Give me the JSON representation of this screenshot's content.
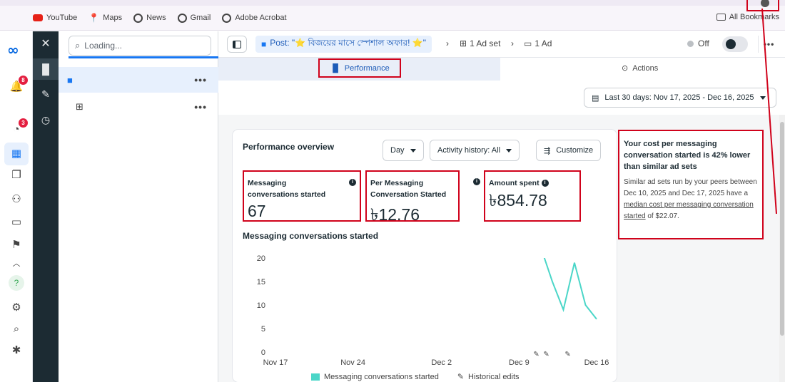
{
  "bookmarks": {
    "items": [
      {
        "label": "YouTube",
        "color": "#e62117"
      },
      {
        "label": "Maps",
        "color": "#34a853"
      },
      {
        "label": "News",
        "color": "#333333"
      },
      {
        "label": "Gmail",
        "color": "#333333"
      },
      {
        "label": "Adobe Acrobat",
        "color": "#333333"
      }
    ],
    "all_label": "All Bookmarks"
  },
  "rail": {
    "notifications_badge": "8",
    "alerts_badge": "3"
  },
  "tree": {
    "search_placeholder": "Loading..."
  },
  "breadcrumb": {
    "post_label": "Post: \"⭐ বিজয়ের মাসে স্পেশাল অফার! ⭐\"",
    "adset_label": "1 Ad set",
    "ad_label": "1 Ad"
  },
  "status": {
    "label": "Off"
  },
  "tabs": {
    "performance": "Performance",
    "actions": "Actions"
  },
  "date_range": "Last 30 days: Nov 17, 2025 - Dec 16, 2025",
  "overview": {
    "title": "Performance overview",
    "granularity": "Day",
    "activity": "Activity history: All",
    "customize": "Customize"
  },
  "metrics": [
    {
      "label": "Messaging conversations started",
      "value": "67"
    },
    {
      "label": "Per Messaging Conversation Started",
      "value": "৳12.76"
    },
    {
      "label": "Amount spent",
      "value": "৳854.78"
    }
  ],
  "insight": {
    "title": "Your cost per messaging conversation started is 42% lower than similar ad sets",
    "body_prefix": "Similar ad sets run by your peers between Dec 10, 2025 and Dec 17, 2025 have a ",
    "body_link": "median cost per messaging conversation started",
    "body_suffix": " of $22.07."
  },
  "chart_data": {
    "type": "line",
    "title": "Messaging conversations started",
    "x_ticks": [
      "Nov 17",
      "Nov 24",
      "Dec 2",
      "Dec 9",
      "Dec 16"
    ],
    "y_ticks": [
      0,
      5,
      10,
      15,
      20
    ],
    "ylim": [
      0,
      20
    ],
    "series": [
      {
        "name": "Messaging conversations started",
        "color": "#4bd6c8",
        "x": [
          "Dec 11",
          "Dec 12",
          "Dec 13",
          "Dec 14",
          "Dec 15",
          "Dec 16"
        ],
        "values": [
          22,
          15,
          9,
          19,
          10,
          7
        ]
      }
    ],
    "legend": [
      "Messaging conversations started",
      "Historical edits"
    ],
    "grid": false
  }
}
